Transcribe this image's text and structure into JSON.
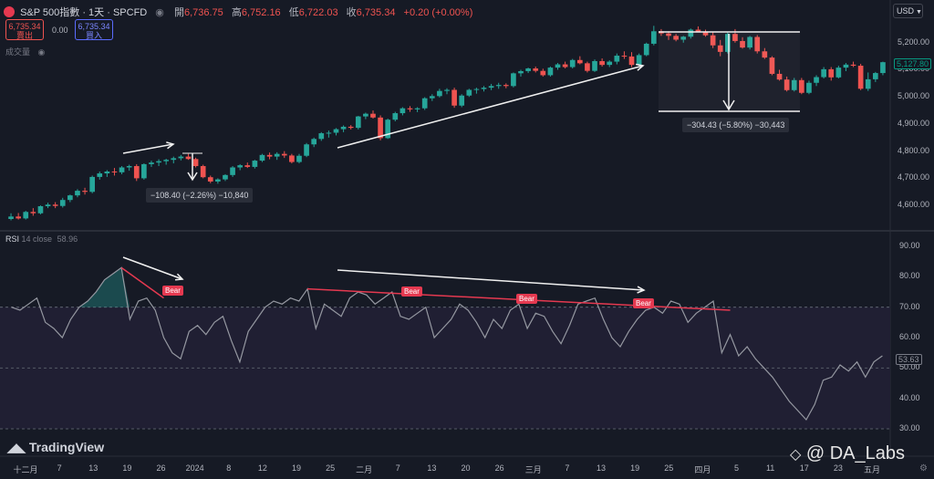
{
  "header": {
    "symbol": "S&P 500指數 · 1天 · SPCFD",
    "open_label": "開",
    "open": "6,736.75",
    "high_label": "高",
    "high": "6,752.16",
    "low_label": "低",
    "low": "6,722.03",
    "close_label": "收",
    "close": "6,735.34",
    "change": "+0.20 (+0.00%)",
    "sell_price": "6,735.34",
    "sell_label": "賣出",
    "spread": "0.00",
    "buy_price": "6,735.34",
    "buy_label": "買入",
    "volume_label": "成交量",
    "currency": "USD"
  },
  "price_axis": {
    "ticks": [
      "5,200.00",
      "5,100.00",
      "5,000.00",
      "4,900.00",
      "4,800.00",
      "4,700.00",
      "4,600.00"
    ],
    "last_price_tag": "5,127.80"
  },
  "rsi": {
    "label": "RSI",
    "params": "14 close",
    "value": "58.96",
    "ticks": [
      "90.00",
      "80.00",
      "70.00",
      "60.00",
      "50.00",
      "40.00",
      "30.00"
    ],
    "last_value_tag": "53.63",
    "bear_label": "Bear"
  },
  "x_axis": {
    "ticks": [
      "十二月",
      "7",
      "13",
      "19",
      "26",
      "2024",
      "8",
      "12",
      "19",
      "25",
      "二月",
      "7",
      "13",
      "20",
      "26",
      "三月",
      "7",
      "13",
      "19",
      "25",
      "四月",
      "5",
      "11",
      "17",
      "23",
      "五月"
    ]
  },
  "annotations": {
    "measure1": "−108.40 (−2.26%) −10,840",
    "measure2": "−304.43 (−5.80%) −30,443"
  },
  "branding": {
    "logo_text": "TradingView",
    "watermark": "@ DA_Labs"
  },
  "colors": {
    "up": "#26a69a",
    "down": "#ef5350",
    "rsi_line": "#9598a1",
    "bear": "#e53950",
    "background": "#161a25"
  },
  "chart_data": {
    "type": "candlestick",
    "symbol": "S&P 500",
    "interval": "1D",
    "candles": [
      [
        4550,
        4571,
        4545,
        4559
      ],
      [
        4559,
        4572,
        4548,
        4552
      ],
      [
        4552,
        4580,
        4548,
        4576
      ],
      [
        4576,
        4590,
        4562,
        4571
      ],
      [
        4571,
        4600,
        4567,
        4597
      ],
      [
        4597,
        4610,
        4590,
        4603
      ],
      [
        4603,
        4612,
        4590,
        4598
      ],
      [
        4598,
        4628,
        4592,
        4620
      ],
      [
        4620,
        4640,
        4612,
        4637
      ],
      [
        4637,
        4660,
        4630,
        4654
      ],
      [
        4654,
        4665,
        4640,
        4650
      ],
      [
        4650,
        4710,
        4645,
        4705
      ],
      [
        4705,
        4725,
        4695,
        4718
      ],
      [
        4718,
        4730,
        4705,
        4725
      ],
      [
        4725,
        4738,
        4710,
        4722
      ],
      [
        4722,
        4745,
        4715,
        4740
      ],
      [
        4740,
        4750,
        4728,
        4745
      ],
      [
        4745,
        4752,
        4690,
        4700
      ],
      [
        4700,
        4755,
        4695,
        4752
      ],
      [
        4752,
        4765,
        4742,
        4758
      ],
      [
        4758,
        4770,
        4745,
        4763
      ],
      [
        4763,
        4772,
        4750,
        4768
      ],
      [
        4768,
        4780,
        4755,
        4774
      ],
      [
        4774,
        4786,
        4766,
        4780
      ],
      [
        4780,
        4790,
        4768,
        4771
      ],
      [
        4771,
        4776,
        4740,
        4745
      ],
      [
        4745,
        4750,
        4700,
        4704
      ],
      [
        4704,
        4710,
        4682,
        4688
      ],
      [
        4688,
        4700,
        4680,
        4696
      ],
      [
        4696,
        4715,
        4690,
        4712
      ],
      [
        4712,
        4745,
        4705,
        4740
      ],
      [
        4740,
        4752,
        4730,
        4748
      ],
      [
        4748,
        4758,
        4738,
        4742
      ],
      [
        4742,
        4768,
        4736,
        4765
      ],
      [
        4765,
        4790,
        4760,
        4786
      ],
      [
        4786,
        4795,
        4770,
        4780
      ],
      [
        4780,
        4796,
        4768,
        4790
      ],
      [
        4790,
        4800,
        4775,
        4784
      ],
      [
        4784,
        4790,
        4755,
        4760
      ],
      [
        4760,
        4790,
        4755,
        4783
      ],
      [
        4783,
        4830,
        4778,
        4825
      ],
      [
        4825,
        4850,
        4815,
        4845
      ],
      [
        4845,
        4870,
        4838,
        4866
      ],
      [
        4866,
        4876,
        4850,
        4868
      ],
      [
        4868,
        4885,
        4858,
        4881
      ],
      [
        4881,
        4895,
        4870,
        4890
      ],
      [
        4890,
        4896,
        4880,
        4886
      ],
      [
        4886,
        4930,
        4880,
        4928
      ],
      [
        4928,
        4942,
        4918,
        4938
      ],
      [
        4938,
        4950,
        4920,
        4924
      ],
      [
        4924,
        4932,
        4840,
        4848
      ],
      [
        4848,
        4920,
        4845,
        4916
      ],
      [
        4916,
        4945,
        4910,
        4940
      ],
      [
        4940,
        4962,
        4932,
        4958
      ],
      [
        4958,
        4966,
        4945,
        4954
      ],
      [
        4954,
        4962,
        4944,
        4958
      ],
      [
        4958,
        4999,
        4952,
        4995
      ],
      [
        4995,
        5010,
        4985,
        5003
      ],
      [
        5003,
        5030,
        4998,
        5022
      ],
      [
        5022,
        5032,
        5010,
        5026
      ],
      [
        5026,
        5034,
        4960,
        4968
      ],
      [
        4968,
        5010,
        4962,
        5005
      ],
      [
        5005,
        5030,
        5000,
        5026
      ],
      [
        5026,
        5034,
        5012,
        5029
      ],
      [
        5029,
        5040,
        5020,
        5034
      ],
      [
        5034,
        5048,
        5025,
        5040
      ],
      [
        5040,
        5052,
        5030,
        5044
      ],
      [
        5044,
        5050,
        5032,
        5040
      ],
      [
        5040,
        5090,
        5035,
        5087
      ],
      [
        5087,
        5100,
        5075,
        5095
      ],
      [
        5095,
        5108,
        5088,
        5105
      ],
      [
        5105,
        5112,
        5090,
        5096
      ],
      [
        5096,
        5104,
        5075,
        5080
      ],
      [
        5080,
        5112,
        5075,
        5108
      ],
      [
        5108,
        5125,
        5100,
        5120
      ],
      [
        5120,
        5130,
        5105,
        5110
      ],
      [
        5110,
        5140,
        5105,
        5136
      ],
      [
        5136,
        5150,
        5120,
        5124
      ],
      [
        5124,
        5130,
        5090,
        5096
      ],
      [
        5096,
        5138,
        5092,
        5132
      ],
      [
        5132,
        5142,
        5112,
        5118
      ],
      [
        5118,
        5135,
        5110,
        5130
      ],
      [
        5130,
        5160,
        5120,
        5152
      ],
      [
        5152,
        5168,
        5140,
        5149
      ],
      [
        5149,
        5165,
        5110,
        5118
      ],
      [
        5118,
        5160,
        5115,
        5154
      ],
      [
        5154,
        5200,
        5150,
        5196
      ],
      [
        5196,
        5262,
        5190,
        5242
      ],
      [
        5242,
        5250,
        5225,
        5234
      ],
      [
        5234,
        5242,
        5210,
        5225
      ],
      [
        5225,
        5232,
        5205,
        5211
      ],
      [
        5211,
        5225,
        5200,
        5222
      ],
      [
        5222,
        5252,
        5215,
        5248
      ],
      [
        5248,
        5260,
        5238,
        5240
      ],
      [
        5240,
        5248,
        5222,
        5227
      ],
      [
        5227,
        5240,
        5180,
        5190
      ],
      [
        5190,
        5210,
        5150,
        5166
      ],
      [
        5166,
        5238,
        5160,
        5232
      ],
      [
        5232,
        5250,
        5200,
        5206
      ],
      [
        5206,
        5220,
        5178,
        5182
      ],
      [
        5182,
        5225,
        5175,
        5221
      ],
      [
        5221,
        5228,
        5160,
        5168
      ],
      [
        5168,
        5180,
        5140,
        5145
      ],
      [
        5145,
        5150,
        5080,
        5085
      ],
      [
        5085,
        5100,
        5060,
        5064
      ],
      [
        5064,
        5075,
        5020,
        5025
      ],
      [
        5025,
        5070,
        5020,
        5062
      ],
      [
        5062,
        5070,
        5010,
        5015
      ],
      [
        5015,
        5060,
        5010,
        5052
      ],
      [
        5052,
        5080,
        5040,
        5073
      ],
      [
        5073,
        5110,
        5068,
        5102
      ],
      [
        5102,
        5110,
        5060,
        5072
      ],
      [
        5072,
        5115,
        5068,
        5108
      ],
      [
        5108,
        5125,
        5095,
        5119
      ],
      [
        5119,
        5130,
        5110,
        5115
      ],
      [
        5115,
        5122,
        5025,
        5030
      ],
      [
        5030,
        5090,
        5022,
        5065
      ],
      [
        5065,
        5092,
        5055,
        5088
      ],
      [
        5088,
        5130,
        5080,
        5128
      ]
    ],
    "rsi": [
      70,
      69,
      71,
      73,
      65,
      63,
      60,
      66,
      70,
      72,
      75,
      79,
      81,
      83,
      66,
      72,
      73,
      69,
      60,
      55,
      53,
      62,
      64,
      61,
      65,
      67,
      59,
      52,
      62,
      66,
      70,
      72,
      71,
      73,
      72,
      76,
      63,
      71,
      69,
      67,
      73,
      75,
      74,
      71,
      73,
      75,
      67,
      66,
      68,
      70,
      60,
      63,
      66,
      71,
      69,
      65,
      60,
      66,
      63,
      69,
      71,
      63,
      68,
      67,
      62,
      58,
      64,
      71,
      72,
      73,
      66,
      60,
      57,
      62,
      66,
      69,
      70,
      68,
      72,
      71,
      65,
      68,
      70,
      72,
      55,
      61,
      54,
      57,
      53,
      50,
      47,
      43,
      39,
      36,
      33,
      38,
      46,
      47,
      51,
      49,
      52,
      47,
      52,
      54
    ],
    "rsi_range": [
      30,
      90
    ],
    "price_range": [
      4550,
      5290
    ],
    "rsi_levels": [
      70,
      50
    ],
    "divergences": [
      "Bear",
      "Bear",
      "Bear",
      "Bear"
    ]
  }
}
